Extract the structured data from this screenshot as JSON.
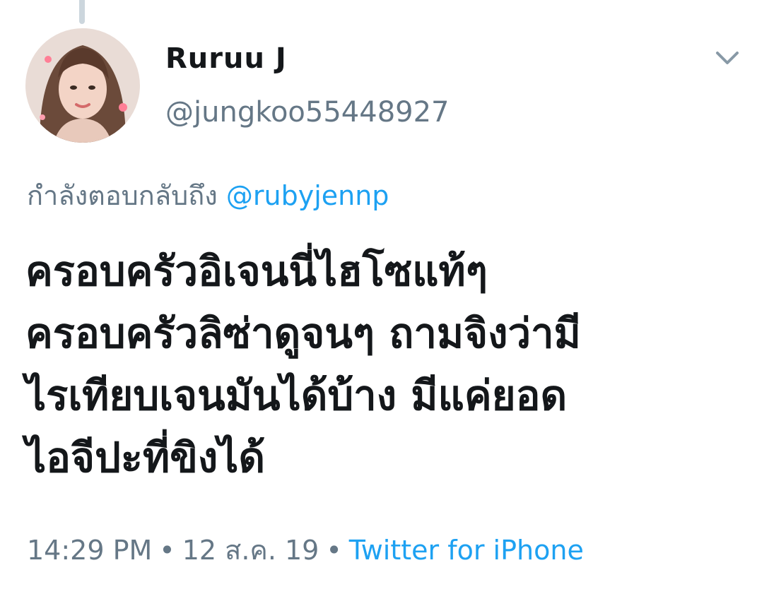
{
  "user": {
    "display_name": "Ruruu J",
    "handle": "@jungkoo55448927",
    "avatar": "profile-photo"
  },
  "reply": {
    "prefix": "กำลังตอบกลับถึง",
    "mention": "@rubyjennp"
  },
  "tweet": {
    "lines": [
      "ครอบครัวอิเจนนี่ไฮโซแท้ๆ",
      "ครอบครัวลิซ่าดูจนๆ ถามจิงว่ามี",
      "ไรเทียบเจนมันได้บ้าง มีแค่ยอด",
      "ไอจีปะที่ขิงได้"
    ]
  },
  "meta": {
    "time": "14:29 PM",
    "separator": "•",
    "date": "12 ส.ค. 19",
    "source": "Twitter for iPhone"
  },
  "icons": {
    "caret": "chevron-down-icon"
  },
  "colors": {
    "text": "#14171a",
    "secondary": "#657786",
    "link": "#1da1f2",
    "thread_line": "#ccd6dd"
  }
}
